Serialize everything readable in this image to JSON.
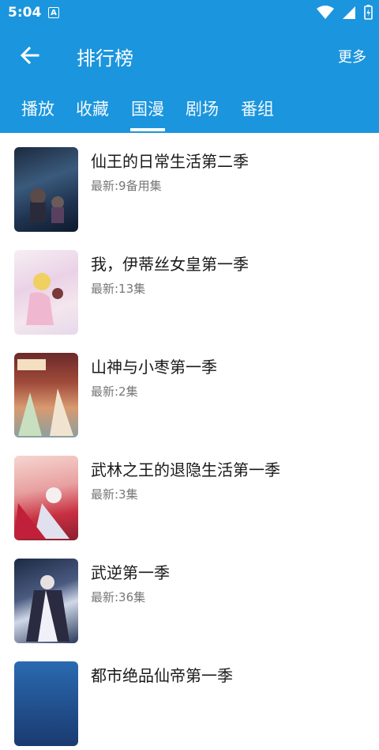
{
  "status": {
    "time": "5:04",
    "notif": "A"
  },
  "toolbar": {
    "title": "排行榜",
    "more": "更多"
  },
  "tabs": [
    {
      "label": "播放"
    },
    {
      "label": "收藏"
    },
    {
      "label": "国漫",
      "active": true
    },
    {
      "label": "剧场"
    },
    {
      "label": "番组"
    }
  ],
  "items": [
    {
      "title": "仙王的日常生活第二季",
      "sub": "最新:9备用集"
    },
    {
      "title": "我，伊蒂丝女皇第一季",
      "sub": "最新:13集"
    },
    {
      "title": "山神与小枣第一季",
      "sub": "最新:2集"
    },
    {
      "title": "武林之王的退隐生活第一季",
      "sub": "最新:3集"
    },
    {
      "title": "武逆第一季",
      "sub": "最新:36集"
    },
    {
      "title": "都市绝品仙帝第一季",
      "sub": ""
    }
  ],
  "colors": {
    "accent": "#1b95dd"
  }
}
